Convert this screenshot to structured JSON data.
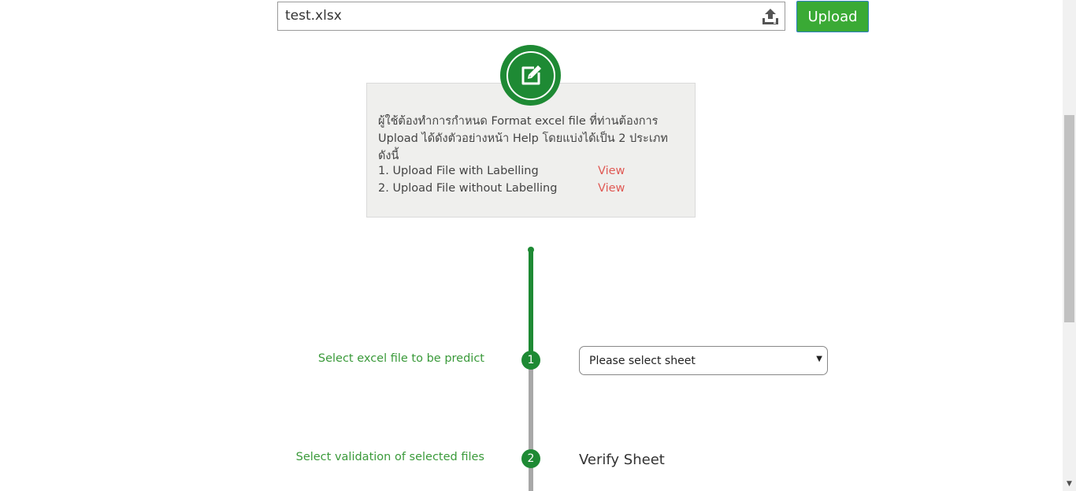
{
  "upload": {
    "file_name": "test.xlsx",
    "button_label": "Upload"
  },
  "help": {
    "description": "ผู้ใช้ต้องทำการกำหนด Format excel file ที่ท่านต้องการ Upload ได้ดังตัวอย่างหน้า Help โดยแบ่งได้เป็น 2 ประเภท ดังนี้",
    "items": [
      {
        "label": "1. Upload File with Labelling",
        "link": "View"
      },
      {
        "label": "2. Upload File without Labelling",
        "link": "View"
      }
    ]
  },
  "steps": [
    {
      "number": "1",
      "label": "Select excel file to be predict"
    },
    {
      "number": "2",
      "label": "Select validation of selected files"
    }
  ],
  "sheet_select": {
    "value": "Please select sheet"
  },
  "verify_sheet": "Verify Sheet",
  "colors": {
    "accent": "#1e8a34",
    "button": "#3aaa35",
    "link": "#e05a55",
    "step_text": "#3a9a3a"
  }
}
